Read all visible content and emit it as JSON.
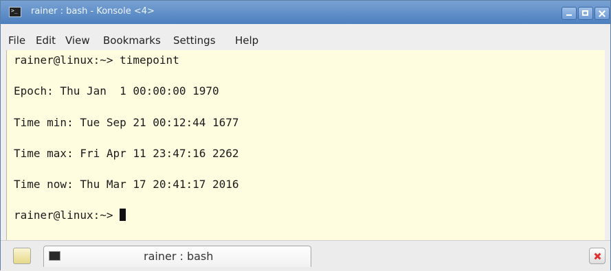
{
  "window": {
    "title": "rainer : bash - Konsole <4>",
    "accent": "#5f8fcb"
  },
  "menu": [
    {
      "label": "File"
    },
    {
      "label": "Edit"
    },
    {
      "label": "View"
    },
    {
      "label": "Bookmarks"
    },
    {
      "label": "Settings"
    },
    {
      "label": "Help"
    }
  ],
  "terminal": {
    "background": "#fffde0",
    "lines": [
      "rainer@linux:~> timepoint",
      "Epoch: Thu Jan  1 00:00:00 1970",
      "Time min: Tue Sep 21 00:12:44 1677",
      "Time max: Fri Apr 11 23:47:16 2262",
      "Time now: Thu Mar 17 20:41:17 2016",
      "rainer@linux:~> "
    ]
  },
  "tabs": [
    {
      "label": "rainer : bash"
    }
  ]
}
